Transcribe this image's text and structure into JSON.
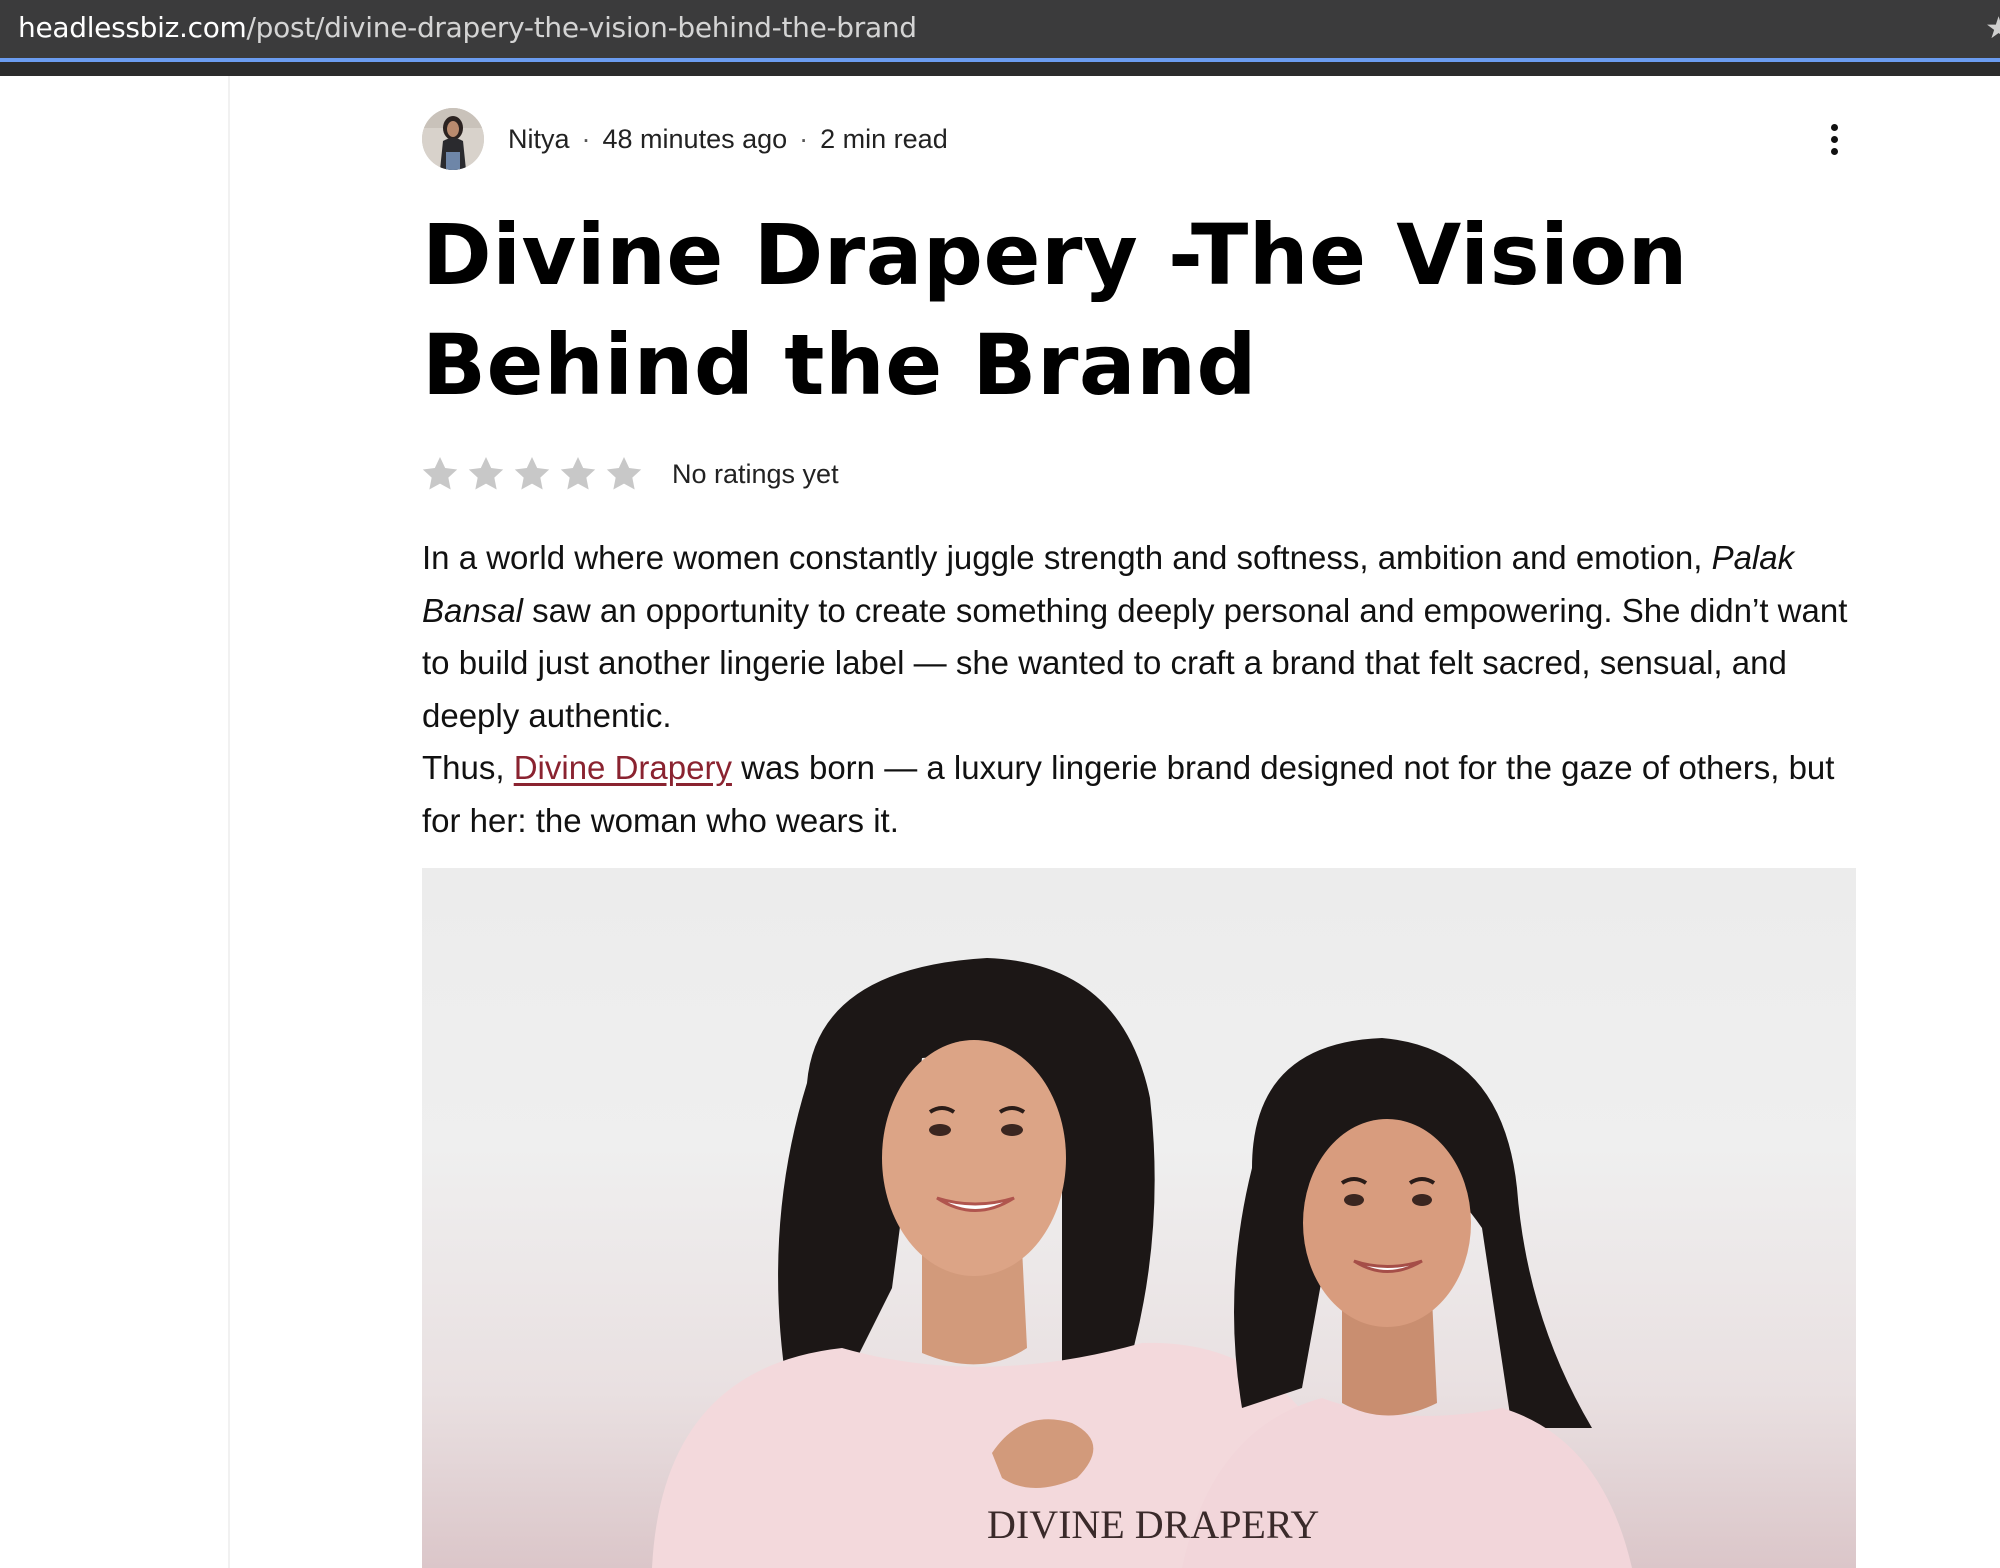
{
  "browser": {
    "url_host": "headlessbiz.com",
    "url_path": "/post/divine-drapery-the-vision-behind-the-brand",
    "loading_progress": 1.0
  },
  "post": {
    "author": "Nitya",
    "separator": "·",
    "time_ago": "48 minutes ago",
    "read_time": "2 min read",
    "title": "Divine Drapery -The Vision Behind the Brand",
    "rating_stars_filled": 0,
    "rating_stars_total": 5,
    "rating_text": "No ratings yet",
    "para1_start": "In a world where women constantly juggle strength and softness, ambition and emotion, ",
    "para1_italic": "Palak Bansal",
    "para1_end": " saw an opportunity to create something deeply personal and empowering. She didn’t want to build just another lingerie label — she wanted to craft a brand that felt sacred, sensual, and deeply authentic.",
    "para2_start": "Thus, ",
    "para2_link": "Divine Drapery",
    "para2_end": " was born — a luxury lingerie brand designed not for the gaze of others, but for her: the woman who wears it.",
    "image_shirt_text": "DIVINE DRAPERY"
  },
  "colors": {
    "link": "#8a2330",
    "star_empty": "#c8c8c8",
    "address_bar": "#3b3b3c",
    "load_bar": "#6b9cf0"
  },
  "icons": [
    "star-icon",
    "more-options-icon",
    "avatar"
  ]
}
